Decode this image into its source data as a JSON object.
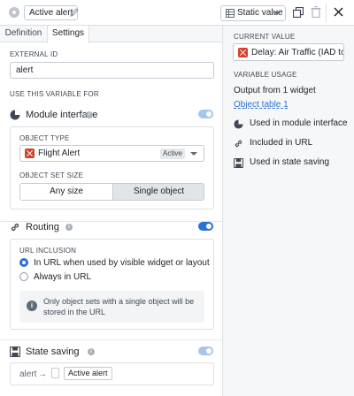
{
  "header": {
    "alert_chip": "Active alert",
    "static_value_label": "Static value"
  },
  "tabs": [
    {
      "label": "Definition"
    },
    {
      "label": "Settings"
    }
  ],
  "settings": {
    "external_id_label": "EXTERNAL ID",
    "external_id_value": "alert",
    "use_for_label": "USE THIS VARIABLE FOR",
    "module_interface": {
      "title": "Module interface",
      "object_type_label": "OBJECT TYPE",
      "object_type_value": "Flight Alert",
      "object_type_badge": "Active",
      "object_set_size_label": "OBJECT SET SIZE",
      "size_options": [
        "Any size",
        "Single object"
      ],
      "selected_size": "Single object"
    },
    "routing": {
      "title": "Routing",
      "url_inclusion_label": "URL INCLUSION",
      "options": [
        "In URL when used by visible widget or layout",
        "Always in URL"
      ],
      "selected": "In URL when used by visible widget or layout",
      "callout": "Only object sets with a single object will be stored in the URL"
    },
    "state_saving": {
      "title": "State saving",
      "mapping_key": "alert",
      "mapping_arrow": "→",
      "mapping_value": "Active alert"
    }
  },
  "right_panel": {
    "current_value_label": "CURRENT VALUE",
    "current_value": "Delay: Air Traffic (IAD to...",
    "variable_usage_label": "VARIABLE USAGE",
    "output_text": "Output from 1 widget",
    "output_link": "Object table 1",
    "usage_items": [
      {
        "icon": "module-interface-icon",
        "label": "Used in module interface"
      },
      {
        "icon": "link-icon",
        "label": "Included in URL"
      },
      {
        "icon": "save-icon",
        "label": "Used in state saving"
      }
    ]
  },
  "colors": {
    "accent": "#2d72d2",
    "flag_red": "#d6412b"
  }
}
